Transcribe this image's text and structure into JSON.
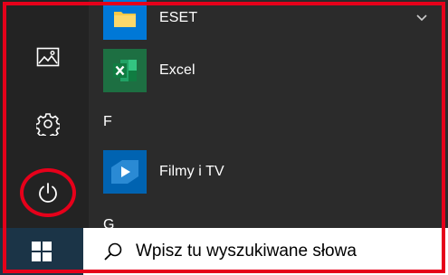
{
  "start_menu": {
    "rail": {
      "pictures_icon": "image-icon",
      "settings_icon": "gear-icon",
      "power_icon": "power-icon"
    },
    "apps": [
      {
        "label": "ESET",
        "icon": "folder-icon",
        "tile_color": "#0078d7"
      },
      {
        "label": "Excel",
        "icon": "excel-icon",
        "tile_color": "#1d6f42"
      },
      {
        "letter": "F"
      },
      {
        "label": "Filmy i TV",
        "icon": "film-tv-icon",
        "tile_color": "#0063b1"
      },
      {
        "letter": "G"
      }
    ]
  },
  "taskbar": {
    "start_icon": "windows-logo-icon",
    "search": {
      "placeholder": "Wpisz tu wyszukiwane słowa",
      "icon": "search-icon"
    }
  },
  "colors": {
    "highlight": "#e6001a",
    "menu_bg": "#2b2b2b",
    "taskbar_bg": "#1e3a4e"
  }
}
